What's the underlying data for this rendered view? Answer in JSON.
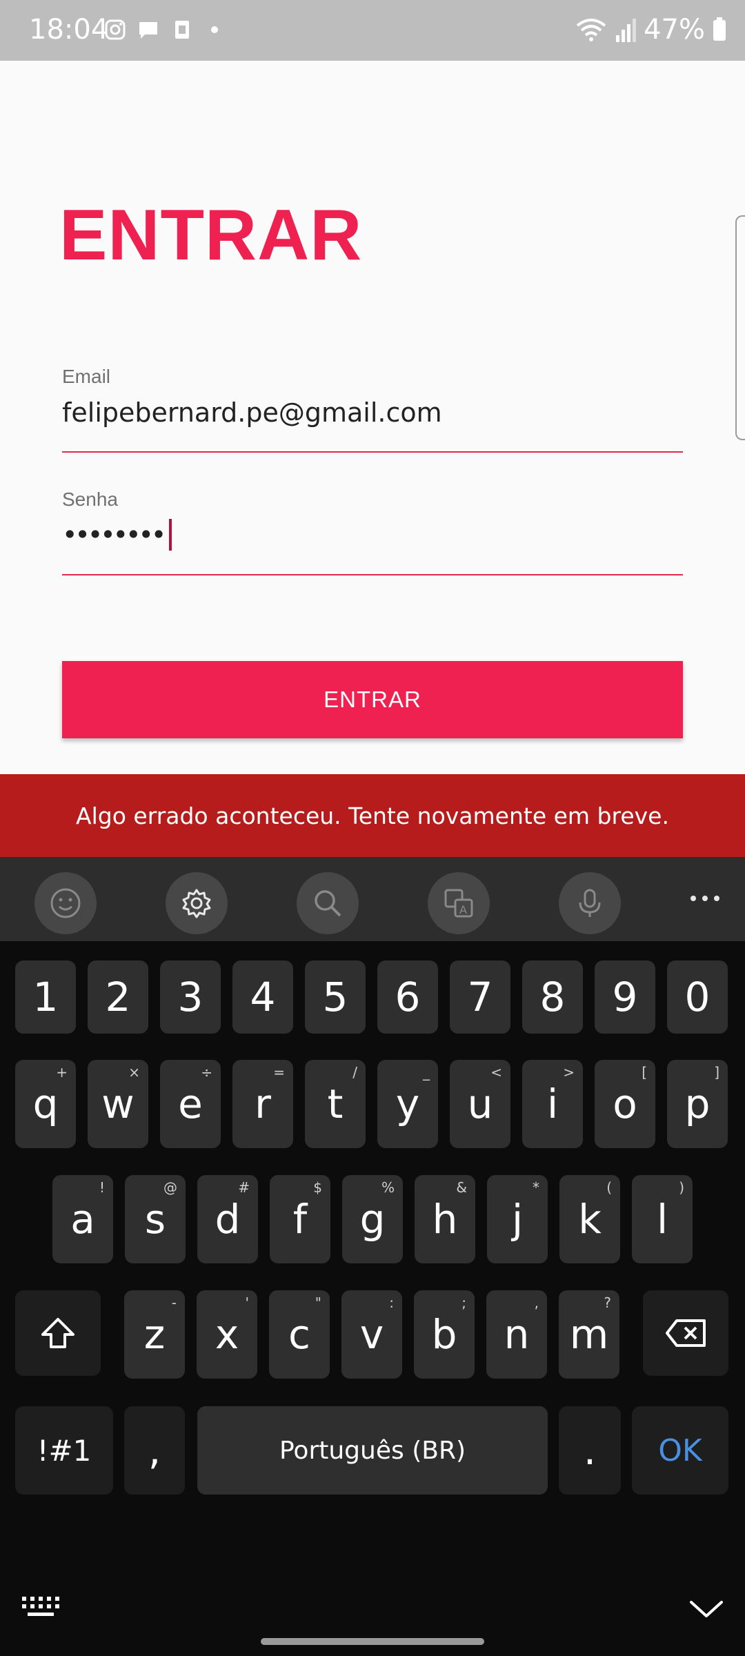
{
  "status_bar": {
    "time": "18:04",
    "battery": "47%"
  },
  "login": {
    "title": "ENTRAR",
    "email_label": "Email",
    "email_value": "felipebernard.pe@gmail.com",
    "password_label": "Senha",
    "password_mask": "••••••••",
    "submit_label": "ENTRAR"
  },
  "snackbar": {
    "message": "Algo errado aconteceu. Tente novamente em breve."
  },
  "keyboard": {
    "number_row": [
      "1",
      "2",
      "3",
      "4",
      "5",
      "6",
      "7",
      "8",
      "9",
      "0"
    ],
    "row1": [
      {
        "key": "q",
        "sub": "+"
      },
      {
        "key": "w",
        "sub": "×"
      },
      {
        "key": "e",
        "sub": "÷"
      },
      {
        "key": "r",
        "sub": "="
      },
      {
        "key": "t",
        "sub": "/"
      },
      {
        "key": "y",
        "sub": "_"
      },
      {
        "key": "u",
        "sub": "<"
      },
      {
        "key": "i",
        "sub": ">"
      },
      {
        "key": "o",
        "sub": "["
      },
      {
        "key": "p",
        "sub": "]"
      }
    ],
    "row2": [
      {
        "key": "a",
        "sub": "!"
      },
      {
        "key": "s",
        "sub": "@"
      },
      {
        "key": "d",
        "sub": "#"
      },
      {
        "key": "f",
        "sub": "$"
      },
      {
        "key": "g",
        "sub": "%"
      },
      {
        "key": "h",
        "sub": "&"
      },
      {
        "key": "j",
        "sub": "*"
      },
      {
        "key": "k",
        "sub": "("
      },
      {
        "key": "l",
        "sub": ")"
      }
    ],
    "row3": [
      {
        "key": "z",
        "sub": "-"
      },
      {
        "key": "x",
        "sub": "'"
      },
      {
        "key": "c",
        "sub": "\""
      },
      {
        "key": "v",
        "sub": ":"
      },
      {
        "key": "b",
        "sub": ";"
      },
      {
        "key": "n",
        "sub": ","
      },
      {
        "key": "m",
        "sub": "?"
      }
    ],
    "symbols_label": "!#1",
    "comma_label": ",",
    "space_label": "Português (BR)",
    "period_label": ".",
    "ok_label": "OK",
    "toolbar_icons": [
      "emoji-icon",
      "settings-icon",
      "search-icon",
      "translate-icon",
      "microphone-icon",
      "more-icon"
    ]
  },
  "colors": {
    "accent": "#ef2150",
    "snackbar": "#b71c1c",
    "ok": "#4a90e2"
  }
}
